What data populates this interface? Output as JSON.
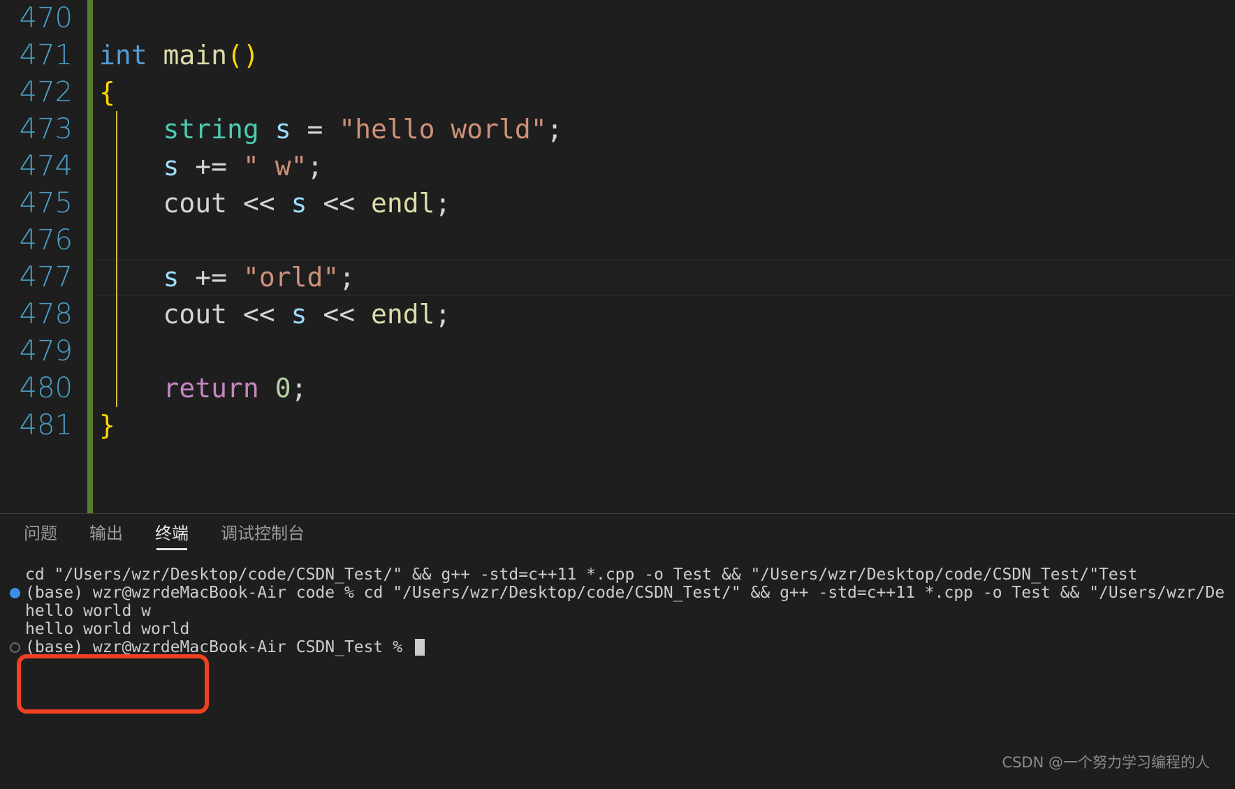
{
  "editor": {
    "language": "cpp",
    "first_line_number": 470,
    "active_line_number": 477,
    "colors": {
      "background": "#1e1e1e",
      "line_number": "#4a9ec4",
      "modified_gutter_bar": "#587c2f",
      "indent_guide": "#d7ba4a"
    },
    "lines": [
      {
        "num": "470",
        "tokens": []
      },
      {
        "num": "471",
        "tokens": [
          {
            "t": "int",
            "c": "tok-kw"
          },
          {
            "t": " ",
            "c": "tok-plain"
          },
          {
            "t": "main",
            "c": "tok-fn"
          },
          {
            "t": "()",
            "c": "tok-paren"
          }
        ]
      },
      {
        "num": "472",
        "tokens": [
          {
            "t": "{",
            "c": "tok-brace"
          }
        ]
      },
      {
        "num": "473",
        "tokens": [
          {
            "t": "    ",
            "c": "tok-plain"
          },
          {
            "t": "string",
            "c": "tok-type"
          },
          {
            "t": " ",
            "c": "tok-plain"
          },
          {
            "t": "s",
            "c": "tok-var"
          },
          {
            "t": " ",
            "c": "tok-plain"
          },
          {
            "t": "=",
            "c": "tok-op"
          },
          {
            "t": " ",
            "c": "tok-plain"
          },
          {
            "t": "\"hello world\"",
            "c": "tok-str"
          },
          {
            "t": ";",
            "c": "tok-op"
          }
        ]
      },
      {
        "num": "474",
        "tokens": [
          {
            "t": "    ",
            "c": "tok-plain"
          },
          {
            "t": "s",
            "c": "tok-var"
          },
          {
            "t": " ",
            "c": "tok-plain"
          },
          {
            "t": "+=",
            "c": "tok-op"
          },
          {
            "t": " ",
            "c": "tok-plain"
          },
          {
            "t": "\" w\"",
            "c": "tok-str"
          },
          {
            "t": ";",
            "c": "tok-op"
          }
        ]
      },
      {
        "num": "475",
        "tokens": [
          {
            "t": "    ",
            "c": "tok-plain"
          },
          {
            "t": "cout",
            "c": "tok-plain"
          },
          {
            "t": " ",
            "c": "tok-plain"
          },
          {
            "t": "<<",
            "c": "tok-op"
          },
          {
            "t": " ",
            "c": "tok-plain"
          },
          {
            "t": "s",
            "c": "tok-var"
          },
          {
            "t": " ",
            "c": "tok-plain"
          },
          {
            "t": "<<",
            "c": "tok-op"
          },
          {
            "t": " ",
            "c": "tok-plain"
          },
          {
            "t": "endl",
            "c": "tok-fn"
          },
          {
            "t": ";",
            "c": "tok-op"
          }
        ]
      },
      {
        "num": "476",
        "tokens": []
      },
      {
        "num": "477",
        "active": true,
        "tokens": [
          {
            "t": "    ",
            "c": "tok-plain"
          },
          {
            "t": "s",
            "c": "tok-var"
          },
          {
            "t": " ",
            "c": "tok-plain"
          },
          {
            "t": "+=",
            "c": "tok-op"
          },
          {
            "t": " ",
            "c": "tok-plain"
          },
          {
            "t": "\"orld\"",
            "c": "tok-str"
          },
          {
            "t": ";",
            "c": "tok-op"
          }
        ]
      },
      {
        "num": "478",
        "tokens": [
          {
            "t": "    ",
            "c": "tok-plain"
          },
          {
            "t": "cout",
            "c": "tok-plain"
          },
          {
            "t": " ",
            "c": "tok-plain"
          },
          {
            "t": "<<",
            "c": "tok-op"
          },
          {
            "t": " ",
            "c": "tok-plain"
          },
          {
            "t": "s",
            "c": "tok-var"
          },
          {
            "t": " ",
            "c": "tok-plain"
          },
          {
            "t": "<<",
            "c": "tok-op"
          },
          {
            "t": " ",
            "c": "tok-plain"
          },
          {
            "t": "endl",
            "c": "tok-fn"
          },
          {
            "t": ";",
            "c": "tok-op"
          }
        ]
      },
      {
        "num": "479",
        "tokens": []
      },
      {
        "num": "480",
        "tokens": [
          {
            "t": "    ",
            "c": "tok-plain"
          },
          {
            "t": "return",
            "c": "tok-ctrl"
          },
          {
            "t": " ",
            "c": "tok-plain"
          },
          {
            "t": "0",
            "c": "tok-num"
          },
          {
            "t": ";",
            "c": "tok-op"
          }
        ]
      },
      {
        "num": "481",
        "tokens": [
          {
            "t": "}",
            "c": "tok-brace"
          }
        ]
      }
    ]
  },
  "panel": {
    "tabs": [
      {
        "label": "问题",
        "active": false
      },
      {
        "label": "输出",
        "active": false
      },
      {
        "label": "终端",
        "active": true
      },
      {
        "label": "调试控制台",
        "active": false
      }
    ]
  },
  "terminal": {
    "lines": [
      {
        "text": "cd \"/Users/wzr/Desktop/code/CSDN_Test/\" && g++ -std=c++11 *.cpp -o Test && \"/Users/wzr/Desktop/code/CSDN_Test/\"Test",
        "decoration": "none"
      },
      {
        "text": "(base) wzr@wzrdeMacBook-Air code % cd \"/Users/wzr/Desktop/code/CSDN_Test/\" && g++ -std=c++11 *.cpp -o Test && \"/Users/wzr/De",
        "decoration": "filled"
      },
      {
        "text": "hello world w",
        "decoration": "none"
      },
      {
        "text": "hello world world",
        "decoration": "none"
      },
      {
        "text": "(base) wzr@wzrdeMacBook-Air CSDN_Test % ",
        "decoration": "hollow",
        "cursor": true
      }
    ],
    "annotation": {
      "shape": "rounded-rect",
      "color": "#f04122",
      "highlights": [
        "hello world w",
        "hello world world"
      ]
    }
  },
  "watermark": {
    "text": "CSDN @一个努力学习编程的人"
  }
}
